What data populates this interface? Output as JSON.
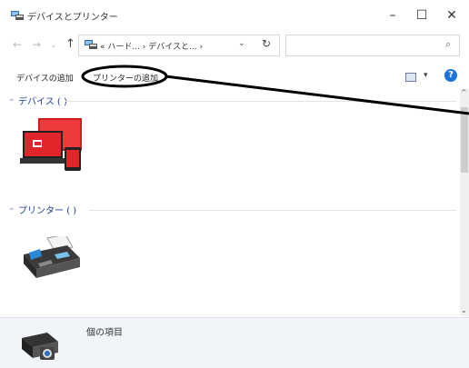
{
  "window": {
    "title": "デバイスとプリンター",
    "controls": {
      "minimize": "–",
      "maximize": "☐",
      "close": "✕"
    }
  },
  "address_bar": {
    "back_icon": "←",
    "forward_icon": "→",
    "recent_icon": "⌄",
    "up_icon": "↑",
    "path": "« ハード... › デバイスと... ›",
    "dropdown_icon": "⌄",
    "refresh_icon": "↻",
    "search_icon": "⌕"
  },
  "command_bar": {
    "add_device": "デバイスの追加",
    "add_printer": "プリンターの追加",
    "view_dropdown": "▾",
    "help": "?"
  },
  "groups": {
    "devices": {
      "chevron": "⌄",
      "label": "デバイス ( )"
    },
    "printers": {
      "chevron": "⌄",
      "label": "プリンター ( )"
    }
  },
  "scrollbar": {
    "up": "^",
    "down": "⌄"
  },
  "details": {
    "text": "個の項目"
  },
  "colors": {
    "group_label": "#1f3f8a",
    "help_icon": "#1e73d8",
    "laptop_red": "#e0262a",
    "annotation": "#000000"
  }
}
